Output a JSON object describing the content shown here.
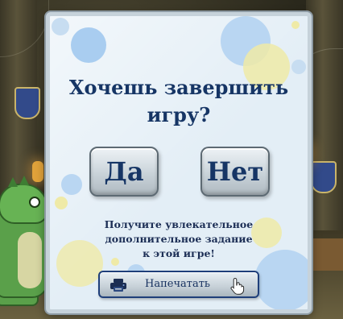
{
  "dialog": {
    "title": "Хочешь завершить\nигру?",
    "yes_label": "Да",
    "no_label": "Нет",
    "promo_text": "Получите увлекательное\nдополнительное задание\nк этой игре!",
    "print_label": "Напечатать",
    "print_icon": "printer-icon",
    "cursor_icon": "hand-pointer-icon"
  },
  "colors": {
    "title_text": "#163565",
    "panel_background": "#e3eef6",
    "button_border": "#1f3f7a"
  }
}
